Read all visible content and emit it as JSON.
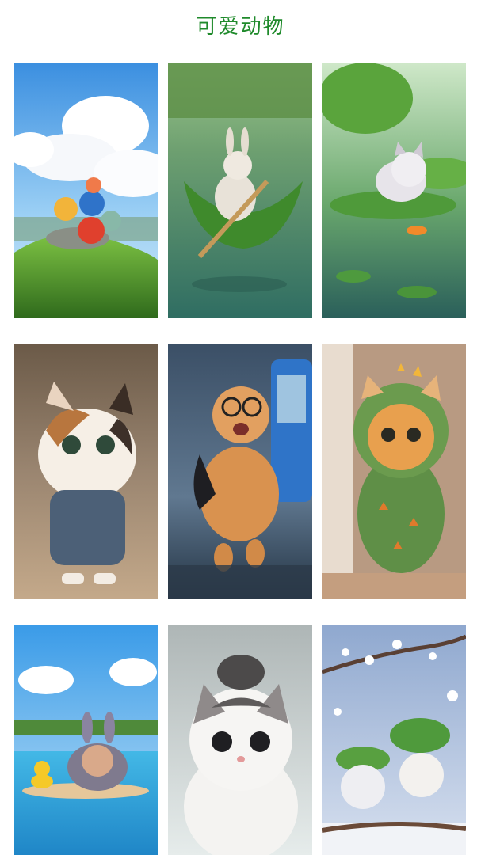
{
  "page": {
    "title": "可爱动物"
  },
  "gallery": {
    "items": [
      {
        "name": "birds-on-hill-image"
      },
      {
        "name": "rabbit-leaf-boat-image"
      },
      {
        "name": "kitten-lotus-pond-image"
      },
      {
        "name": "calico-kitten-overalls-image"
      },
      {
        "name": "running-cat-glasses-image"
      },
      {
        "name": "cat-dinosaur-costume-image"
      },
      {
        "name": "bunny-hood-pool-image"
      },
      {
        "name": "grey-white-fluffy-cat-image"
      },
      {
        "name": "kittens-lotus-leaf-snow-image"
      }
    ]
  },
  "colors": {
    "title": "#1f8a2b",
    "background": "#ffffff"
  }
}
